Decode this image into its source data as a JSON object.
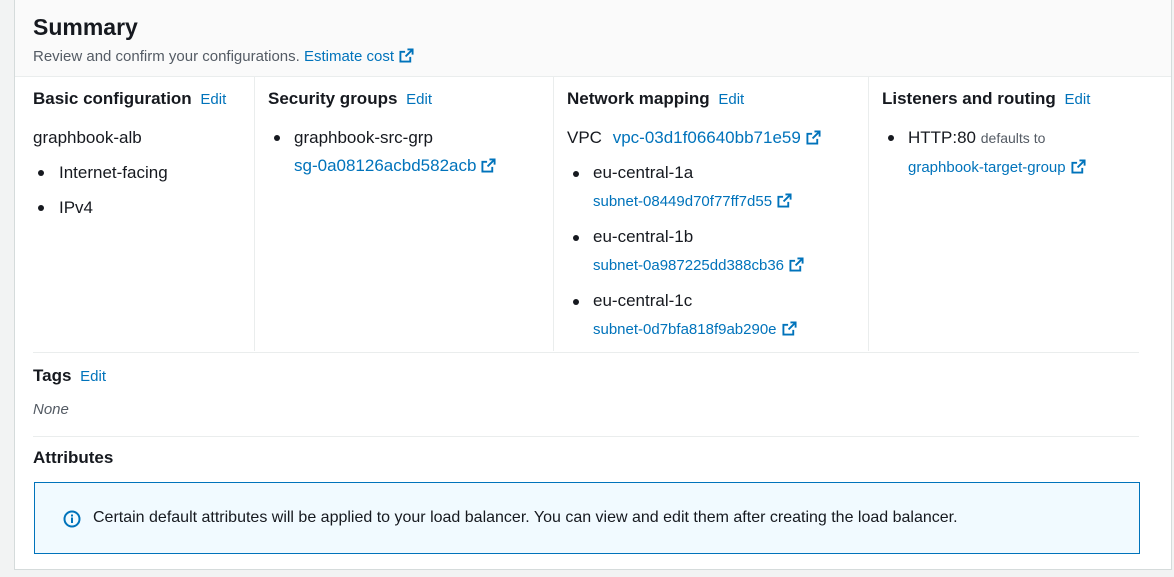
{
  "summary": {
    "title": "Summary",
    "subtitle": "Review and confirm your configurations.",
    "estimate_link": "Estimate cost"
  },
  "edit_label": "Edit",
  "basic": {
    "heading": "Basic configuration",
    "name": "graphbook-alb",
    "items": [
      "Internet-facing",
      "IPv4"
    ]
  },
  "security": {
    "heading": "Security groups",
    "group_name": "graphbook-src-grp",
    "group_id": "sg-0a08126acbd582acb"
  },
  "network": {
    "heading": "Network mapping",
    "vpc_label": "VPC",
    "vpc_id": "vpc-03d1f06640bb71e59",
    "zones": [
      {
        "zone": "eu-central-1a",
        "subnet": "subnet-08449d70f77ff7d55"
      },
      {
        "zone": "eu-central-1b",
        "subnet": "subnet-0a987225dd388cb36"
      },
      {
        "zone": "eu-central-1c",
        "subnet": "subnet-0d7bfa818f9ab290e"
      }
    ]
  },
  "listeners": {
    "heading": "Listeners and routing",
    "protocol": "HTTP:80",
    "defaults_to": "defaults to",
    "target_group": "graphbook-target-group"
  },
  "tags": {
    "heading": "Tags",
    "value": "None"
  },
  "attributes": {
    "heading": "Attributes",
    "info": "Certain default attributes will be applied to your load balancer. You can view and edit them after creating the load balancer."
  },
  "colors": {
    "link": "#0073bb",
    "text": "#16191f",
    "muted": "#545b64",
    "info_border": "#0073bb",
    "info_bg": "#f1faff"
  }
}
